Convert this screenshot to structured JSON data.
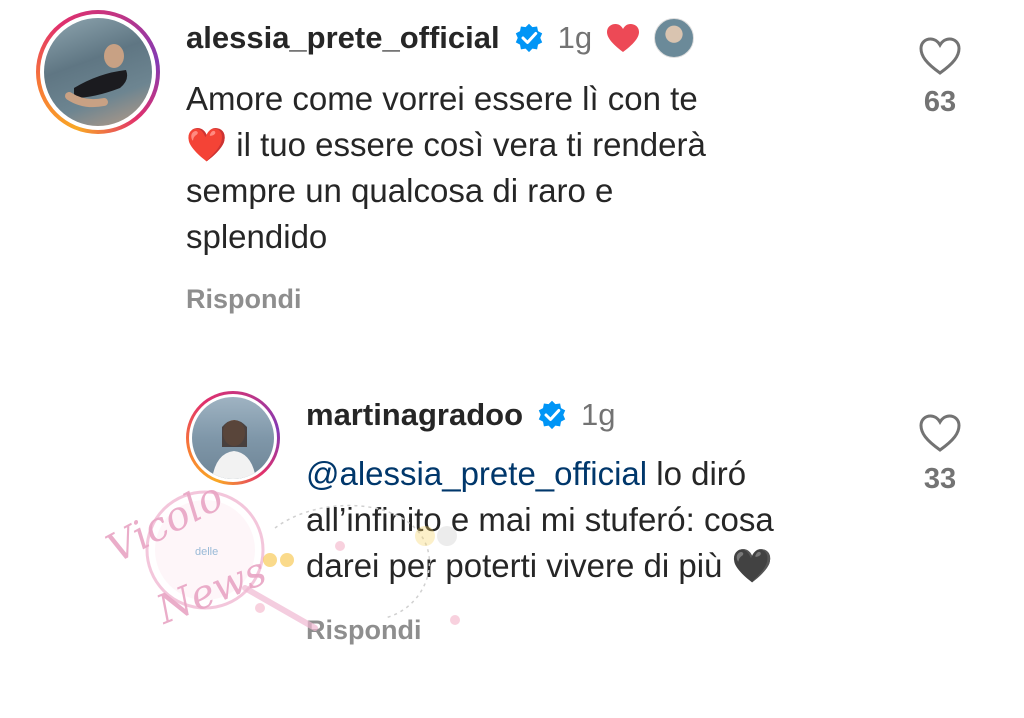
{
  "comments": [
    {
      "username": "alessia_prete_official",
      "time": "1g",
      "text_line1": "Amore come vorrei essere lì con te",
      "text_line2": " il tuo essere così vera ti renderà",
      "text_line3": "sempre un qualcosa di raro e",
      "text_line4": "splendido",
      "reply_label": "Rispondi",
      "like_count": "63",
      "heart_emoji": "❤️"
    },
    {
      "username": "martinagradoo",
      "time": "1g",
      "mention": "@alessia_prete_official",
      "text_line1_rest": " lo diró",
      "text_line2": "all’infinito e mai mi stuferó: cosa",
      "text_line3": "darei per poterti vivere di più ",
      "reply_label": "Rispondi",
      "like_count": "33",
      "heart_emoji": "🖤"
    }
  ],
  "watermark": {
    "script_text": "Vicolo",
    "small_text": "delle",
    "script_text2": "News"
  },
  "colors": {
    "verified": "#0095f6",
    "liked_heart": "#ed4956",
    "mention": "#00376b",
    "watermark": "#e8a5c4"
  }
}
